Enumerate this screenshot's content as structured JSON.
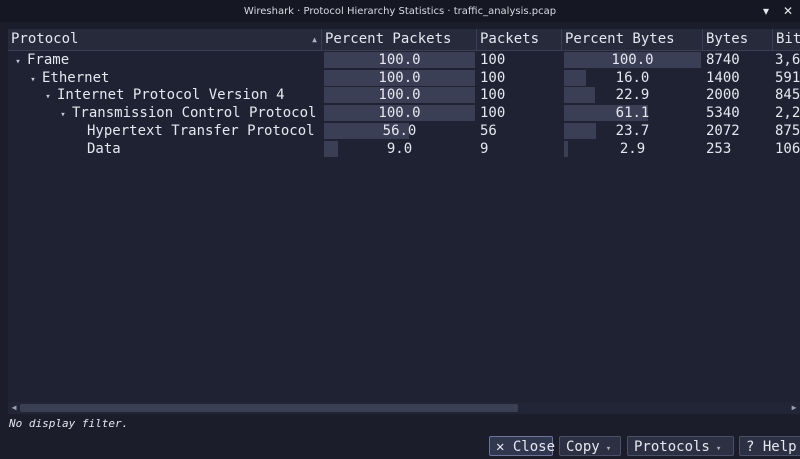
{
  "window": {
    "title": "Wireshark · Protocol Hierarchy Statistics · traffic_analysis.pcap",
    "minimize_glyph": "▾",
    "close_glyph": "✕"
  },
  "table": {
    "columns": [
      "Protocol",
      "Percent Packets",
      "Packets",
      "Percent Bytes",
      "Bytes",
      "Bits/s"
    ],
    "column_header_truncated": {
      "Bits/s": "Bit"
    },
    "sort_indicator": "▲",
    "rows": [
      {
        "protocol": "Frame",
        "expander": "▾",
        "percent_packets": "100.0",
        "percent_packets_value": 100.0,
        "packets": "100",
        "percent_bytes": "100.0",
        "percent_bytes_value": 100.0,
        "bytes": "8740",
        "bits": "3,6"
      },
      {
        "protocol": "Ethernet",
        "expander": "▾",
        "percent_packets": "100.0",
        "percent_packets_value": 100.0,
        "packets": "100",
        "percent_bytes": "16.0",
        "percent_bytes_value": 16.0,
        "bytes": "1400",
        "bits": "591"
      },
      {
        "protocol": "Internet Protocol Version 4",
        "expander": "▾",
        "percent_packets": "100.0",
        "percent_packets_value": 100.0,
        "packets": "100",
        "percent_bytes": "22.9",
        "percent_bytes_value": 22.9,
        "bytes": "2000",
        "bits": "845"
      },
      {
        "protocol": "Transmission Control Protocol",
        "expander": "▾",
        "percent_packets": "100.0",
        "percent_packets_value": 100.0,
        "packets": "100",
        "percent_bytes": "61.1",
        "percent_bytes_value": 61.1,
        "bytes": "5340",
        "bits": "2,2"
      },
      {
        "protocol": "Hypertext Transfer Protocol",
        "expander": "",
        "percent_packets": "56.0",
        "percent_packets_value": 56.0,
        "packets": "56",
        "percent_bytes": "23.7",
        "percent_bytes_value": 23.7,
        "bytes": "2072",
        "bits": "875"
      },
      {
        "protocol": "Data",
        "expander": "",
        "percent_packets": "9.0",
        "percent_packets_value": 9.0,
        "packets": "9",
        "percent_bytes": "2.9",
        "percent_bytes_value": 2.9,
        "bytes": "253",
        "bits": "106"
      }
    ]
  },
  "scrollbar": {
    "left_glyph": "◀",
    "right_glyph": "▶"
  },
  "status": {
    "text": "No display filter."
  },
  "buttons": {
    "close": "✕ Close",
    "copy": "Copy",
    "protocols": "Protocols",
    "help": "? Help",
    "dropdown_glyph": "▾"
  },
  "colors": {
    "background": "#1b1d2a",
    "bar": "#3a3f55",
    "header": "#262a3b"
  }
}
